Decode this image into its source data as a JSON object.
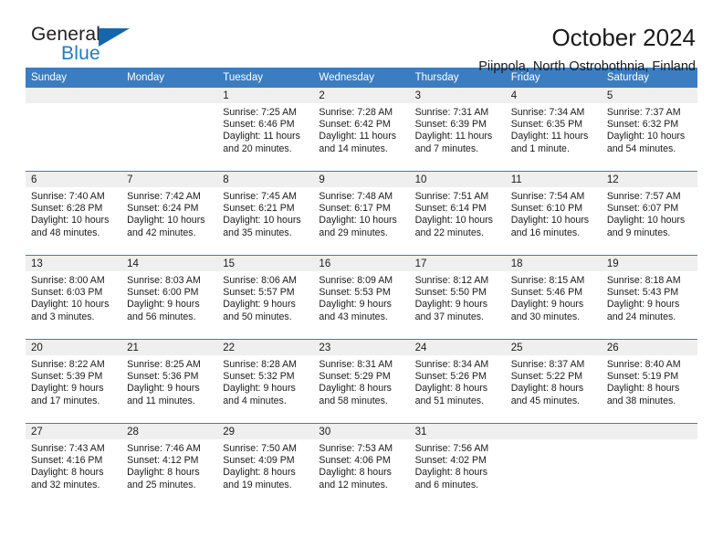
{
  "brand": {
    "name_top": "General",
    "name_bottom": "Blue",
    "triangle_color": "#1567ad",
    "blue_color": "#1f7bc1"
  },
  "header": {
    "title": "October 2024",
    "subtitle": "Piippola, North Ostrobothnia, Finland"
  },
  "theme": {
    "header_blue": "#3b7dc0",
    "daynum_gray": "#efefef"
  },
  "weekday_headers": [
    "Sunday",
    "Monday",
    "Tuesday",
    "Wednesday",
    "Thursday",
    "Friday",
    "Saturday"
  ],
  "labels": {
    "sunrise_prefix": "Sunrise:",
    "sunset_prefix": "Sunset:",
    "daylight_prefix": "Daylight:"
  },
  "weeks": [
    [
      {
        "day": "",
        "sunrise": "",
        "sunset": "",
        "daylight_line1": "",
        "daylight_line2": ""
      },
      {
        "day": "",
        "sunrise": "",
        "sunset": "",
        "daylight_line1": "",
        "daylight_line2": ""
      },
      {
        "day": "1",
        "sunrise": "Sunrise: 7:25 AM",
        "sunset": "Sunset: 6:46 PM",
        "daylight_line1": "Daylight: 11 hours",
        "daylight_line2": "and 20 minutes."
      },
      {
        "day": "2",
        "sunrise": "Sunrise: 7:28 AM",
        "sunset": "Sunset: 6:42 PM",
        "daylight_line1": "Daylight: 11 hours",
        "daylight_line2": "and 14 minutes."
      },
      {
        "day": "3",
        "sunrise": "Sunrise: 7:31 AM",
        "sunset": "Sunset: 6:39 PM",
        "daylight_line1": "Daylight: 11 hours",
        "daylight_line2": "and 7 minutes."
      },
      {
        "day": "4",
        "sunrise": "Sunrise: 7:34 AM",
        "sunset": "Sunset: 6:35 PM",
        "daylight_line1": "Daylight: 11 hours",
        "daylight_line2": "and 1 minute."
      },
      {
        "day": "5",
        "sunrise": "Sunrise: 7:37 AM",
        "sunset": "Sunset: 6:32 PM",
        "daylight_line1": "Daylight: 10 hours",
        "daylight_line2": "and 54 minutes."
      }
    ],
    [
      {
        "day": "6",
        "sunrise": "Sunrise: 7:40 AM",
        "sunset": "Sunset: 6:28 PM",
        "daylight_line1": "Daylight: 10 hours",
        "daylight_line2": "and 48 minutes."
      },
      {
        "day": "7",
        "sunrise": "Sunrise: 7:42 AM",
        "sunset": "Sunset: 6:24 PM",
        "daylight_line1": "Daylight: 10 hours",
        "daylight_line2": "and 42 minutes."
      },
      {
        "day": "8",
        "sunrise": "Sunrise: 7:45 AM",
        "sunset": "Sunset: 6:21 PM",
        "daylight_line1": "Daylight: 10 hours",
        "daylight_line2": "and 35 minutes."
      },
      {
        "day": "9",
        "sunrise": "Sunrise: 7:48 AM",
        "sunset": "Sunset: 6:17 PM",
        "daylight_line1": "Daylight: 10 hours",
        "daylight_line2": "and 29 minutes."
      },
      {
        "day": "10",
        "sunrise": "Sunrise: 7:51 AM",
        "sunset": "Sunset: 6:14 PM",
        "daylight_line1": "Daylight: 10 hours",
        "daylight_line2": "and 22 minutes."
      },
      {
        "day": "11",
        "sunrise": "Sunrise: 7:54 AM",
        "sunset": "Sunset: 6:10 PM",
        "daylight_line1": "Daylight: 10 hours",
        "daylight_line2": "and 16 minutes."
      },
      {
        "day": "12",
        "sunrise": "Sunrise: 7:57 AM",
        "sunset": "Sunset: 6:07 PM",
        "daylight_line1": "Daylight: 10 hours",
        "daylight_line2": "and 9 minutes."
      }
    ],
    [
      {
        "day": "13",
        "sunrise": "Sunrise: 8:00 AM",
        "sunset": "Sunset: 6:03 PM",
        "daylight_line1": "Daylight: 10 hours",
        "daylight_line2": "and 3 minutes."
      },
      {
        "day": "14",
        "sunrise": "Sunrise: 8:03 AM",
        "sunset": "Sunset: 6:00 PM",
        "daylight_line1": "Daylight: 9 hours",
        "daylight_line2": "and 56 minutes."
      },
      {
        "day": "15",
        "sunrise": "Sunrise: 8:06 AM",
        "sunset": "Sunset: 5:57 PM",
        "daylight_line1": "Daylight: 9 hours",
        "daylight_line2": "and 50 minutes."
      },
      {
        "day": "16",
        "sunrise": "Sunrise: 8:09 AM",
        "sunset": "Sunset: 5:53 PM",
        "daylight_line1": "Daylight: 9 hours",
        "daylight_line2": "and 43 minutes."
      },
      {
        "day": "17",
        "sunrise": "Sunrise: 8:12 AM",
        "sunset": "Sunset: 5:50 PM",
        "daylight_line1": "Daylight: 9 hours",
        "daylight_line2": "and 37 minutes."
      },
      {
        "day": "18",
        "sunrise": "Sunrise: 8:15 AM",
        "sunset": "Sunset: 5:46 PM",
        "daylight_line1": "Daylight: 9 hours",
        "daylight_line2": "and 30 minutes."
      },
      {
        "day": "19",
        "sunrise": "Sunrise: 8:18 AM",
        "sunset": "Sunset: 5:43 PM",
        "daylight_line1": "Daylight: 9 hours",
        "daylight_line2": "and 24 minutes."
      }
    ],
    [
      {
        "day": "20",
        "sunrise": "Sunrise: 8:22 AM",
        "sunset": "Sunset: 5:39 PM",
        "daylight_line1": "Daylight: 9 hours",
        "daylight_line2": "and 17 minutes."
      },
      {
        "day": "21",
        "sunrise": "Sunrise: 8:25 AM",
        "sunset": "Sunset: 5:36 PM",
        "daylight_line1": "Daylight: 9 hours",
        "daylight_line2": "and 11 minutes."
      },
      {
        "day": "22",
        "sunrise": "Sunrise: 8:28 AM",
        "sunset": "Sunset: 5:32 PM",
        "daylight_line1": "Daylight: 9 hours",
        "daylight_line2": "and 4 minutes."
      },
      {
        "day": "23",
        "sunrise": "Sunrise: 8:31 AM",
        "sunset": "Sunset: 5:29 PM",
        "daylight_line1": "Daylight: 8 hours",
        "daylight_line2": "and 58 minutes."
      },
      {
        "day": "24",
        "sunrise": "Sunrise: 8:34 AM",
        "sunset": "Sunset: 5:26 PM",
        "daylight_line1": "Daylight: 8 hours",
        "daylight_line2": "and 51 minutes."
      },
      {
        "day": "25",
        "sunrise": "Sunrise: 8:37 AM",
        "sunset": "Sunset: 5:22 PM",
        "daylight_line1": "Daylight: 8 hours",
        "daylight_line2": "and 45 minutes."
      },
      {
        "day": "26",
        "sunrise": "Sunrise: 8:40 AM",
        "sunset": "Sunset: 5:19 PM",
        "daylight_line1": "Daylight: 8 hours",
        "daylight_line2": "and 38 minutes."
      }
    ],
    [
      {
        "day": "27",
        "sunrise": "Sunrise: 7:43 AM",
        "sunset": "Sunset: 4:16 PM",
        "daylight_line1": "Daylight: 8 hours",
        "daylight_line2": "and 32 minutes."
      },
      {
        "day": "28",
        "sunrise": "Sunrise: 7:46 AM",
        "sunset": "Sunset: 4:12 PM",
        "daylight_line1": "Daylight: 8 hours",
        "daylight_line2": "and 25 minutes."
      },
      {
        "day": "29",
        "sunrise": "Sunrise: 7:50 AM",
        "sunset": "Sunset: 4:09 PM",
        "daylight_line1": "Daylight: 8 hours",
        "daylight_line2": "and 19 minutes."
      },
      {
        "day": "30",
        "sunrise": "Sunrise: 7:53 AM",
        "sunset": "Sunset: 4:06 PM",
        "daylight_line1": "Daylight: 8 hours",
        "daylight_line2": "and 12 minutes."
      },
      {
        "day": "31",
        "sunrise": "Sunrise: 7:56 AM",
        "sunset": "Sunset: 4:02 PM",
        "daylight_line1": "Daylight: 8 hours",
        "daylight_line2": "and 6 minutes."
      },
      {
        "day": "",
        "sunrise": "",
        "sunset": "",
        "daylight_line1": "",
        "daylight_line2": ""
      },
      {
        "day": "",
        "sunrise": "",
        "sunset": "",
        "daylight_line1": "",
        "daylight_line2": ""
      }
    ]
  ]
}
